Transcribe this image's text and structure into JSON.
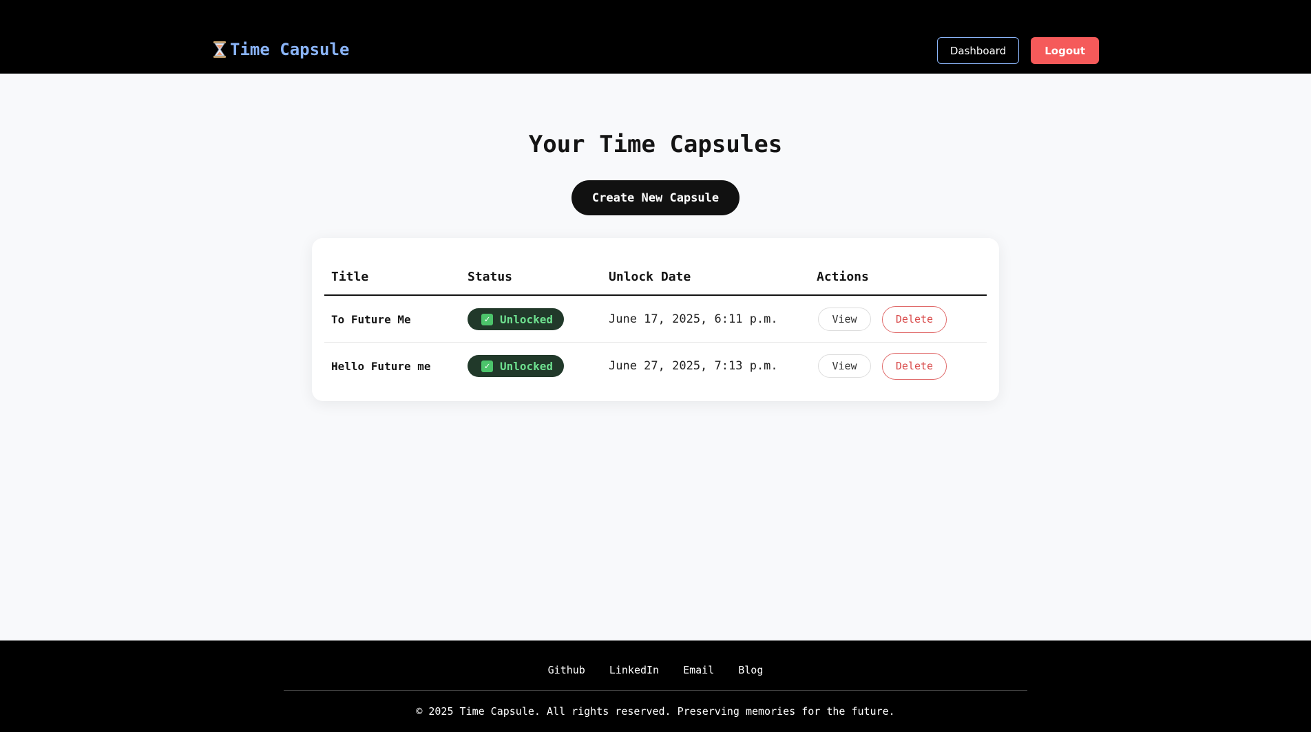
{
  "header": {
    "brand_icon": "hourglass-icon",
    "brand_text": "Time Capsule",
    "dashboard_label": "Dashboard",
    "logout_label": "Logout"
  },
  "main": {
    "title": "Your Time Capsules",
    "create_label": "Create New Capsule",
    "table": {
      "columns": [
        "Title",
        "Status",
        "Unlock Date",
        "Actions"
      ],
      "rows": [
        {
          "title": "To Future Me",
          "status": "Unlocked",
          "unlock_date": "June 17, 2025, 6:11 p.m.",
          "view_label": "View",
          "delete_label": "Delete"
        },
        {
          "title": "Hello Future me",
          "status": "Unlocked",
          "unlock_date": "June 27, 2025, 7:13 p.m.",
          "view_label": "View",
          "delete_label": "Delete"
        }
      ]
    }
  },
  "footer": {
    "links": [
      "Github",
      "LinkedIn",
      "Email",
      "Blog"
    ],
    "copyright": "© 2025 Time Capsule. All rights reserved. Preserving memories for the future."
  },
  "colors": {
    "header_bg": "#000000",
    "brand": "#8ab4f8",
    "logout": "#f55a5a",
    "badge_bg": "#21392a",
    "badge_text": "#6ee08f",
    "delete": "#d94b4b"
  }
}
